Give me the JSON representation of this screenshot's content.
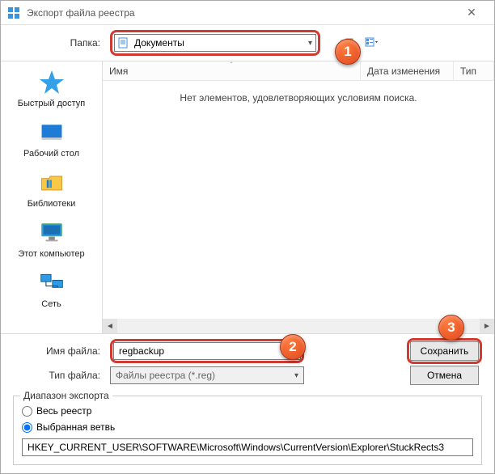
{
  "title": "Экспорт файла реестра",
  "folder": {
    "label": "Папка:",
    "value": "Документы"
  },
  "sidebar": [
    {
      "label": "Быстрый доступ"
    },
    {
      "label": "Рабочий стол"
    },
    {
      "label": "Библиотеки"
    },
    {
      "label": "Этот компьютер"
    },
    {
      "label": "Сеть"
    }
  ],
  "list": {
    "col_name": "Имя",
    "col_date": "Дата изменения",
    "col_type": "Тип",
    "empty": "Нет элементов, удовлетворяющих условиям поиска."
  },
  "filename": {
    "label": "Имя файла:",
    "value": "regbackup"
  },
  "filetype": {
    "label": "Тип файла:",
    "value": "Файлы реестра (*.reg)"
  },
  "buttons": {
    "save": "Сохранить",
    "cancel": "Отмена"
  },
  "range": {
    "legend": "Диапазон экспорта",
    "all": "Весь реестр",
    "selected": "Выбранная ветвь",
    "branch": "HKEY_CURRENT_USER\\SOFTWARE\\Microsoft\\Windows\\CurrentVersion\\Explorer\\StuckRects3"
  },
  "callouts": {
    "c1": "1",
    "c2": "2",
    "c3": "3"
  }
}
